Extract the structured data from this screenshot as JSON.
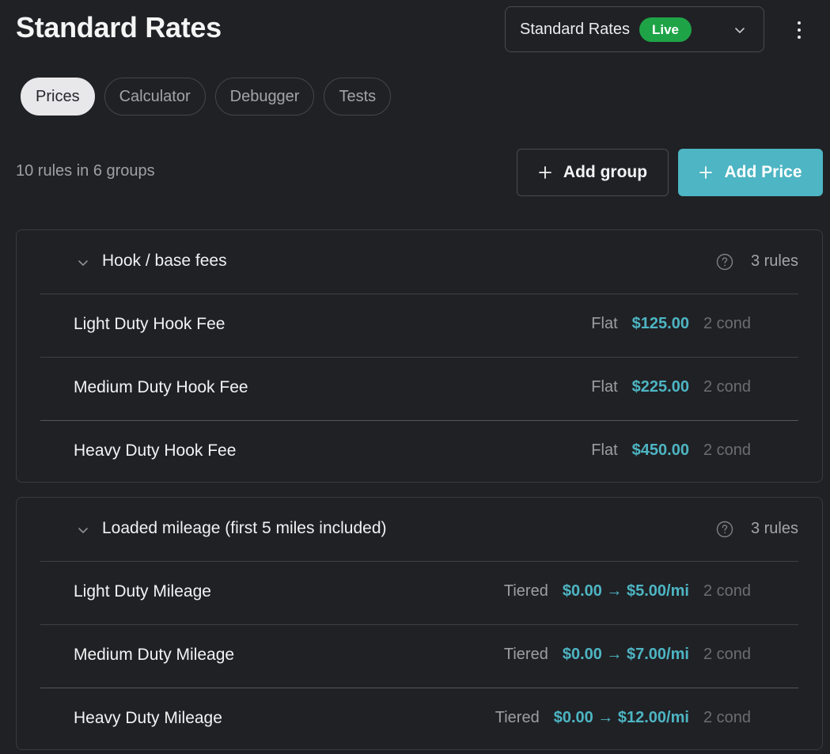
{
  "header": {
    "title": "Standard Rates",
    "version_select": {
      "label": "Standard Rates",
      "badge": "Live"
    }
  },
  "tabs": [
    {
      "label": "Prices",
      "active": true
    },
    {
      "label": "Calculator",
      "active": false
    },
    {
      "label": "Debugger",
      "active": false
    },
    {
      "label": "Tests",
      "active": false
    }
  ],
  "summary": "10 rules in 6 groups",
  "actions": {
    "add_group": "Add group",
    "add_price": "Add Price"
  },
  "colors": {
    "accent": "#4db5c3",
    "live": "#1ea447",
    "background": "#202125"
  },
  "groups": [
    {
      "title": "Hook / base fees",
      "count": "3 rules",
      "rules": [
        {
          "name": "Light Duty Hook Fee",
          "type": "Flat",
          "price": "$125.00",
          "cond": "2 cond"
        },
        {
          "name": "Medium Duty Hook Fee",
          "type": "Flat",
          "price": "$225.00",
          "cond": "2 cond"
        },
        {
          "name": "Heavy Duty Hook Fee",
          "type": "Flat",
          "price": "$450.00",
          "cond": "2 cond"
        }
      ]
    },
    {
      "title": "Loaded mileage (first 5 miles included)",
      "count": "3 rules",
      "rules": [
        {
          "name": "Light Duty Mileage",
          "type": "Tiered",
          "price": "$0.00 → $5.00/mi",
          "cond": "2 cond"
        },
        {
          "name": "Medium Duty Mileage",
          "type": "Tiered",
          "price": "$0.00 → $7.00/mi",
          "cond": "2 cond"
        },
        {
          "name": "Heavy Duty Mileage",
          "type": "Tiered",
          "price": "$0.00 → $12.00/mi",
          "cond": "2 cond"
        }
      ]
    }
  ]
}
